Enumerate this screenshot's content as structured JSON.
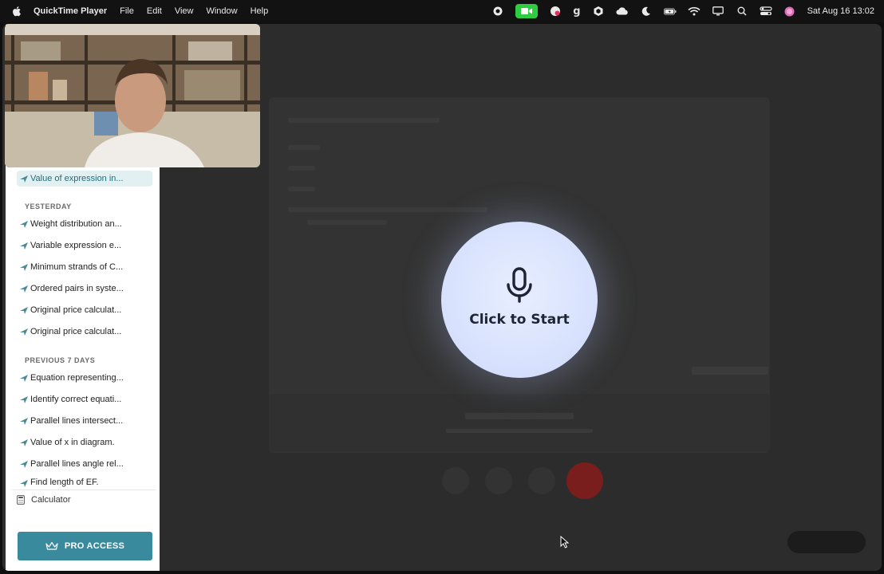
{
  "menubar": {
    "app_name": "QuickTime Player",
    "menus": [
      "File",
      "Edit",
      "View",
      "Window",
      "Help"
    ],
    "clock": "Sat Aug 16  13:02",
    "status_icons": [
      "record-icon",
      "facetime-icon",
      "extension-icon",
      "g-icon",
      "hex-icon",
      "cloud-icon",
      "moon-icon",
      "battery-icon",
      "wifi-icon",
      "display-icon",
      "search-icon",
      "control-center-icon",
      "siri-icon"
    ],
    "g_letter": "g"
  },
  "sidebar": {
    "active_item": "Value of expression in...",
    "sections": [
      {
        "title": "YESTERDAY",
        "items": [
          "Weight distribution an...",
          "Variable expression e...",
          "Minimum strands of C...",
          "Ordered pairs in syste...",
          "Original price calculat...",
          "Original price calculat..."
        ]
      },
      {
        "title": "PREVIOUS 7 DAYS",
        "items": [
          "Equation representing...",
          "Identify correct equati...",
          "Parallel lines intersect...",
          "Value of x in diagram.",
          "Parallel lines angle rel...",
          "Find length of EF."
        ]
      }
    ],
    "calculator_label": "Calculator",
    "pro_label": "PRO ACCESS"
  },
  "main": {
    "start_label": "Click to Start"
  },
  "colors": {
    "accent": "#3a8a9e",
    "start_bg": "#d6e0fd",
    "facetime_green": "#2ecc40"
  }
}
